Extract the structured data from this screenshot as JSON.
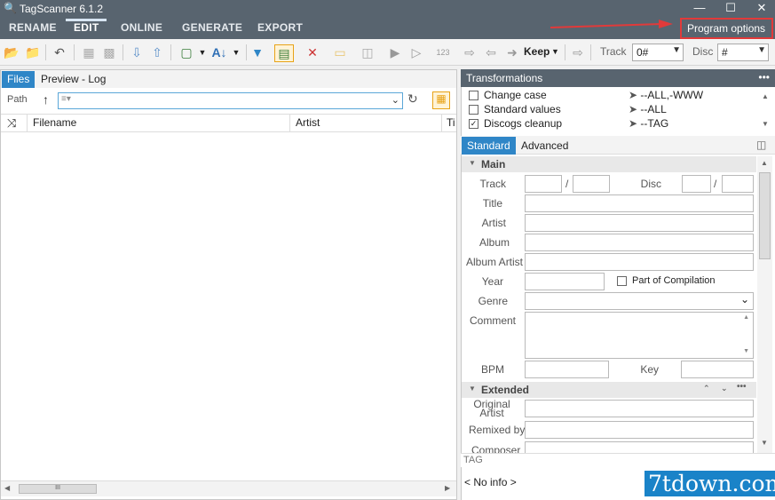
{
  "window": {
    "title": "TagScanner 6.1.2"
  },
  "menu": {
    "rename": "RENAME",
    "edit": "EDIT",
    "online": "ONLINE",
    "generate": "GENERATE",
    "export": "EXPORT",
    "program_options": "Program options"
  },
  "toolbar": {
    "keep": "Keep",
    "track_label": "Track",
    "track_value": "0#",
    "disc_label": "Disc",
    "disc_value": "#"
  },
  "left": {
    "tabs": [
      "Files",
      "Preview - Log"
    ],
    "path_label": "Path",
    "columns": [
      "Filename",
      "Artist",
      "Ti"
    ],
    "scroll_grip": "III"
  },
  "transformations": {
    "header": "Transformations",
    "items": [
      {
        "label": "Change case",
        "value": "--ALL,-WWW",
        "checked": false
      },
      {
        "label": "Standard values",
        "value": "--ALL",
        "checked": false
      },
      {
        "label": "Discogs cleanup",
        "value": "--TAG",
        "checked": true
      }
    ]
  },
  "tag_tabs": [
    "Standard",
    "Advanced"
  ],
  "sections": {
    "main": "Main",
    "extended": "Extended"
  },
  "fields": {
    "track": "Track",
    "disc": "Disc",
    "title": "Title",
    "artist": "Artist",
    "album": "Album",
    "album_artist": "Album Artist",
    "year": "Year",
    "compilation": "Part of Compilation",
    "genre": "Genre",
    "comment": "Comment",
    "bpm": "BPM",
    "key": "Key",
    "original_artist": "Original Artist",
    "remixed_by": "Remixed by",
    "composer": "Composer",
    "slash": "/"
  },
  "tagbar": "TAG",
  "noinfo": "< No info >",
  "watermark": "7tdown.com"
}
